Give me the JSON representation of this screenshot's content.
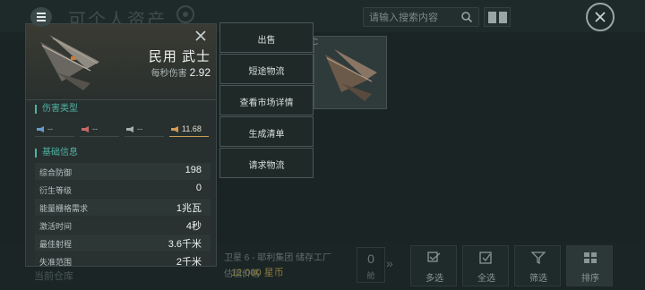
{
  "header": {
    "title": "可个人资产",
    "search_placeholder": "请输入搜索内容"
  },
  "item": {
    "name": "民用 武士",
    "dps_label": "每秒伤害",
    "dps_value": "2.92"
  },
  "damage": {
    "label": "伤害类型",
    "values": [
      "--",
      "--",
      "--",
      "11.68"
    ]
  },
  "basic": {
    "label": "基础信息",
    "rows": [
      {
        "key": "综合防御",
        "value": "198"
      },
      {
        "key": "衍生等级",
        "value": "0"
      },
      {
        "key": "能量栅格需求",
        "value": "1兆瓦"
      },
      {
        "key": "激活时间",
        "value": "4秒"
      },
      {
        "key": "最佳射程",
        "value": "3.6千米"
      },
      {
        "key": "失准范围",
        "value": "2千米"
      }
    ]
  },
  "menu": {
    "items": [
      "出售",
      "短途物流",
      "查看市场详情",
      "生成清单",
      "请求物流"
    ]
  },
  "background": {
    "card_label": "C",
    "location": "卫星 6 - 耶利集团 储存工厂",
    "price_label": "估值价格",
    "price": "12,000 星币",
    "count": "0",
    "count_unit": "舱",
    "hangar": "当前仓库",
    "buttons": [
      "多选",
      "全选",
      "筛选",
      "排序"
    ]
  },
  "colors": {
    "accent": "#4fb2a4",
    "highlight": "#c89a55",
    "panel_bg": "#27302f",
    "menu_bg": "#1f2928"
  }
}
